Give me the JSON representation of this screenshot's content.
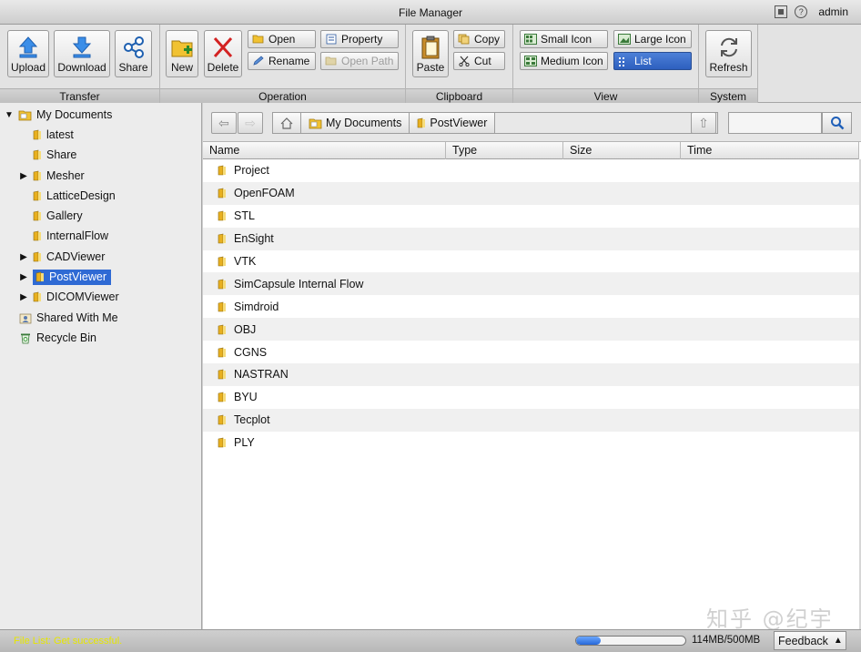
{
  "window": {
    "title": "File Manager",
    "user": "admin"
  },
  "ribbon": {
    "groups": [
      {
        "label": "Transfer"
      },
      {
        "label": "Operation"
      },
      {
        "label": "Clipboard"
      },
      {
        "label": "View"
      },
      {
        "label": "System"
      }
    ],
    "transfer": {
      "upload": "Upload",
      "download": "Download",
      "share": "Share"
    },
    "operation": {
      "new": "New",
      "delete": "Delete",
      "open": "Open",
      "rename": "Rename",
      "property": "Property",
      "open_path": "Open Path"
    },
    "clipboard": {
      "paste": "Paste",
      "copy": "Copy",
      "cut": "Cut"
    },
    "view": {
      "small_icon": "Small Icon",
      "large_icon": "Large Icon",
      "medium_icon": "Medium Icon",
      "list": "List"
    },
    "system": {
      "refresh": "Refresh"
    }
  },
  "tree": {
    "root": "My Documents",
    "items": [
      {
        "label": "latest"
      },
      {
        "label": "Share"
      },
      {
        "label": "Mesher"
      },
      {
        "label": "LatticeDesign"
      },
      {
        "label": "Gallery"
      },
      {
        "label": "InternalFlow"
      },
      {
        "label": "CADViewer"
      },
      {
        "label": "PostViewer"
      },
      {
        "label": "DICOMViewer"
      }
    ],
    "shared": "Shared With Me",
    "recycle": "Recycle Bin"
  },
  "breadcrumb": {
    "home": "My Documents",
    "current": "PostViewer"
  },
  "search": {
    "value": ""
  },
  "columns": {
    "name": "Name",
    "type": "Type",
    "size": "Size",
    "time": "Time"
  },
  "files": [
    {
      "name": "Project"
    },
    {
      "name": "OpenFOAM"
    },
    {
      "name": "STL"
    },
    {
      "name": "EnSight"
    },
    {
      "name": "VTK"
    },
    {
      "name": "SimCapsule Internal Flow"
    },
    {
      "name": "Simdroid"
    },
    {
      "name": "OBJ"
    },
    {
      "name": "CGNS"
    },
    {
      "name": "NASTRAN"
    },
    {
      "name": "BYU"
    },
    {
      "name": "Tecplot"
    },
    {
      "name": "PLY"
    }
  ],
  "status": {
    "message": "File List: Get successful.",
    "quota": "114MB/500MB",
    "quota_fraction": 0.228,
    "feedback": "Feedback"
  },
  "watermark": "知乎 @纪宇",
  "colors": {
    "accent": "#2f6ad4",
    "folder": "#e8b020",
    "status_text": "#e6e600"
  }
}
